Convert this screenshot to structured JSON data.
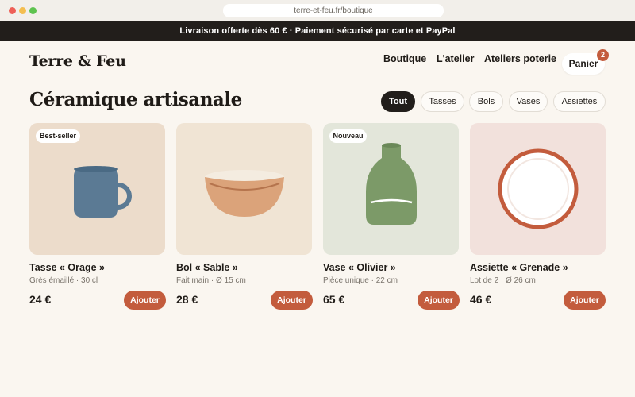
{
  "browser": {
    "url": "terre-et-feu.fr/boutique"
  },
  "promo": {
    "text": "Livraison offerte dès 60 € · Paiement sécurisé par carte et PayPal"
  },
  "header": {
    "logo": "Terre & Feu",
    "nav": [
      "Boutique",
      "L'atelier",
      "Ateliers poterie"
    ],
    "cart_label": "Panier",
    "cart_count": "2"
  },
  "main": {
    "title": "Céramique artisanale",
    "filters": [
      "Tout",
      "Tasses",
      "Bols",
      "Vases",
      "Assiettes"
    ],
    "active_filter": "Tout"
  },
  "products": [
    {
      "name": "Tasse « Orage »",
      "desc": "Grès émaillé · 30 cl",
      "price": "24 €",
      "tag": "Best-seller",
      "add_label": "Ajouter",
      "icon": "mug-icon",
      "bg": "#ecdccb",
      "color": "#5b7a94"
    },
    {
      "name": "Bol « Sable »",
      "desc": "Fait main · Ø 15 cm",
      "price": "28 €",
      "add_label": "Ajouter",
      "icon": "bowl-icon",
      "bg": "#f0e4d4",
      "color": "#dba37a"
    },
    {
      "name": "Vase « Olivier »",
      "desc": "Pièce unique · 22 cm",
      "price": "65 €",
      "tag": "Nouveau",
      "add_label": "Ajouter",
      "icon": "vase-icon",
      "bg": "#e3e6da",
      "color": "#7c9a68"
    },
    {
      "name": "Assiette « Grenade »",
      "desc": "Lot de 2 · Ø 26 cm",
      "price": "46 €",
      "add_label": "Ajouter",
      "icon": "plate-icon",
      "bg": "#f2e1dc",
      "color": "#c35c3d"
    }
  ],
  "colors": {
    "accent": "#c35c3d",
    "dark": "#221e1b",
    "background": "#faf6f0"
  }
}
